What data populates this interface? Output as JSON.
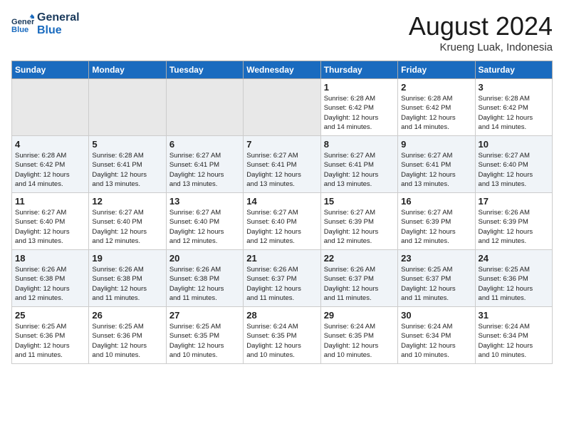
{
  "header": {
    "logo_line1": "General",
    "logo_line2": "Blue",
    "month_title": "August 2024",
    "location": "Krueng Luak, Indonesia"
  },
  "weekdays": [
    "Sunday",
    "Monday",
    "Tuesday",
    "Wednesday",
    "Thursday",
    "Friday",
    "Saturday"
  ],
  "weeks": [
    [
      {
        "day": "",
        "info": ""
      },
      {
        "day": "",
        "info": ""
      },
      {
        "day": "",
        "info": ""
      },
      {
        "day": "",
        "info": ""
      },
      {
        "day": "1",
        "info": "Sunrise: 6:28 AM\nSunset: 6:42 PM\nDaylight: 12 hours\nand 14 minutes."
      },
      {
        "day": "2",
        "info": "Sunrise: 6:28 AM\nSunset: 6:42 PM\nDaylight: 12 hours\nand 14 minutes."
      },
      {
        "day": "3",
        "info": "Sunrise: 6:28 AM\nSunset: 6:42 PM\nDaylight: 12 hours\nand 14 minutes."
      }
    ],
    [
      {
        "day": "4",
        "info": "Sunrise: 6:28 AM\nSunset: 6:42 PM\nDaylight: 12 hours\nand 14 minutes."
      },
      {
        "day": "5",
        "info": "Sunrise: 6:28 AM\nSunset: 6:41 PM\nDaylight: 12 hours\nand 13 minutes."
      },
      {
        "day": "6",
        "info": "Sunrise: 6:27 AM\nSunset: 6:41 PM\nDaylight: 12 hours\nand 13 minutes."
      },
      {
        "day": "7",
        "info": "Sunrise: 6:27 AM\nSunset: 6:41 PM\nDaylight: 12 hours\nand 13 minutes."
      },
      {
        "day": "8",
        "info": "Sunrise: 6:27 AM\nSunset: 6:41 PM\nDaylight: 12 hours\nand 13 minutes."
      },
      {
        "day": "9",
        "info": "Sunrise: 6:27 AM\nSunset: 6:41 PM\nDaylight: 12 hours\nand 13 minutes."
      },
      {
        "day": "10",
        "info": "Sunrise: 6:27 AM\nSunset: 6:40 PM\nDaylight: 12 hours\nand 13 minutes."
      }
    ],
    [
      {
        "day": "11",
        "info": "Sunrise: 6:27 AM\nSunset: 6:40 PM\nDaylight: 12 hours\nand 13 minutes."
      },
      {
        "day": "12",
        "info": "Sunrise: 6:27 AM\nSunset: 6:40 PM\nDaylight: 12 hours\nand 12 minutes."
      },
      {
        "day": "13",
        "info": "Sunrise: 6:27 AM\nSunset: 6:40 PM\nDaylight: 12 hours\nand 12 minutes."
      },
      {
        "day": "14",
        "info": "Sunrise: 6:27 AM\nSunset: 6:40 PM\nDaylight: 12 hours\nand 12 minutes."
      },
      {
        "day": "15",
        "info": "Sunrise: 6:27 AM\nSunset: 6:39 PM\nDaylight: 12 hours\nand 12 minutes."
      },
      {
        "day": "16",
        "info": "Sunrise: 6:27 AM\nSunset: 6:39 PM\nDaylight: 12 hours\nand 12 minutes."
      },
      {
        "day": "17",
        "info": "Sunrise: 6:26 AM\nSunset: 6:39 PM\nDaylight: 12 hours\nand 12 minutes."
      }
    ],
    [
      {
        "day": "18",
        "info": "Sunrise: 6:26 AM\nSunset: 6:38 PM\nDaylight: 12 hours\nand 12 minutes."
      },
      {
        "day": "19",
        "info": "Sunrise: 6:26 AM\nSunset: 6:38 PM\nDaylight: 12 hours\nand 11 minutes."
      },
      {
        "day": "20",
        "info": "Sunrise: 6:26 AM\nSunset: 6:38 PM\nDaylight: 12 hours\nand 11 minutes."
      },
      {
        "day": "21",
        "info": "Sunrise: 6:26 AM\nSunset: 6:37 PM\nDaylight: 12 hours\nand 11 minutes."
      },
      {
        "day": "22",
        "info": "Sunrise: 6:26 AM\nSunset: 6:37 PM\nDaylight: 12 hours\nand 11 minutes."
      },
      {
        "day": "23",
        "info": "Sunrise: 6:25 AM\nSunset: 6:37 PM\nDaylight: 12 hours\nand 11 minutes."
      },
      {
        "day": "24",
        "info": "Sunrise: 6:25 AM\nSunset: 6:36 PM\nDaylight: 12 hours\nand 11 minutes."
      }
    ],
    [
      {
        "day": "25",
        "info": "Sunrise: 6:25 AM\nSunset: 6:36 PM\nDaylight: 12 hours\nand 11 minutes."
      },
      {
        "day": "26",
        "info": "Sunrise: 6:25 AM\nSunset: 6:36 PM\nDaylight: 12 hours\nand 10 minutes."
      },
      {
        "day": "27",
        "info": "Sunrise: 6:25 AM\nSunset: 6:35 PM\nDaylight: 12 hours\nand 10 minutes."
      },
      {
        "day": "28",
        "info": "Sunrise: 6:24 AM\nSunset: 6:35 PM\nDaylight: 12 hours\nand 10 minutes."
      },
      {
        "day": "29",
        "info": "Sunrise: 6:24 AM\nSunset: 6:35 PM\nDaylight: 12 hours\nand 10 minutes."
      },
      {
        "day": "30",
        "info": "Sunrise: 6:24 AM\nSunset: 6:34 PM\nDaylight: 12 hours\nand 10 minutes."
      },
      {
        "day": "31",
        "info": "Sunrise: 6:24 AM\nSunset: 6:34 PM\nDaylight: 12 hours\nand 10 minutes."
      }
    ]
  ]
}
